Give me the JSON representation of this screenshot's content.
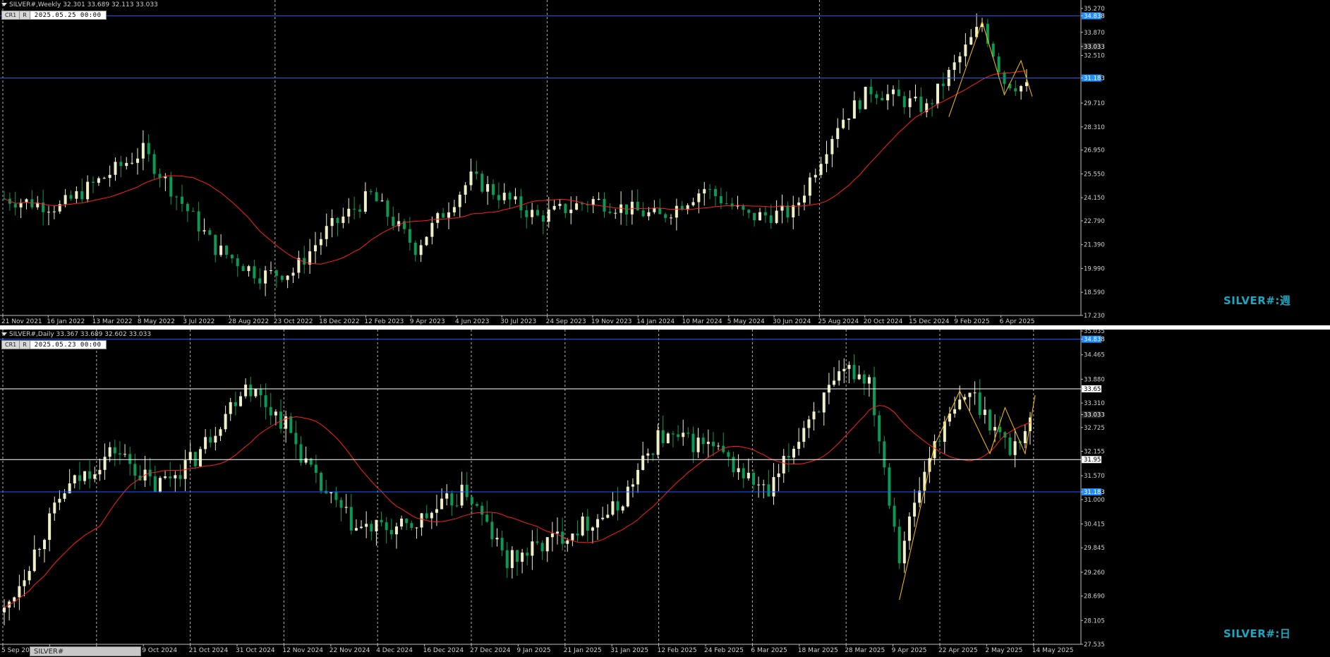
{
  "colors": {
    "bull": "#f0f0c8",
    "bear": "#0a9a55",
    "ma": "#ff2020",
    "zigzag": "#ffc000",
    "hline_blue": "#1e5cff",
    "hline_white": "#ffffff",
    "price_tag": "#1e8cff",
    "grid": "#c0c0c0",
    "text": "#d0d0d0",
    "watermark": "#1aa7c0"
  },
  "weekly": {
    "header": "SILVER#,Weekly  32.301 33.689 32.113 33.033",
    "cr_label": "CR1",
    "r_label": "R",
    "date": "2025.05.25 00:00",
    "watermark": "SILVER#:週",
    "price_labels": [
      "35.270",
      "34.838",
      "33.870",
      "33.033",
      "32.510",
      "31.183",
      "29.710",
      "28.310",
      "26.950",
      "25.550",
      "24.150",
      "22.790",
      "21.390",
      "19.990",
      "18.590",
      "17.230"
    ],
    "time_labels": [
      "21 Nov 2021",
      "16 Jan 2022",
      "13 Mar 2022",
      "8 May 2022",
      "3 Jul 2022",
      "28 Aug 2022",
      "23 Oct 2022",
      "18 Dec 2022",
      "12 Feb 2023",
      "9 Apr 2023",
      "4 Jun 2023",
      "30 Jul 2023",
      "24 Sep 2023",
      "19 Nov 2023",
      "14 Jan 2024",
      "10 Mar 2024",
      "5 May 2024",
      "30 Jun 2024",
      "25 Aug 2024",
      "20 Oct 2024",
      "15 Dec 2024",
      "9 Feb 2025",
      "6 Apr 2025"
    ]
  },
  "daily": {
    "header": "SILVER#,Daily  33.367 33.689 32.602 33.033",
    "cr_label": "CR1",
    "r_label": "R",
    "date": "2025.05.23 00:00",
    "watermark": "SILVER#:日",
    "price_labels": [
      "35.035",
      "34.838",
      "34.465",
      "33.880",
      "33.650",
      "33.310",
      "33.033",
      "32.725",
      "32.155",
      "31.957",
      "31.570",
      "31.183",
      "31.000",
      "30.415",
      "29.845",
      "29.260",
      "28.690",
      "28.105",
      "27.535"
    ],
    "time_labels": [
      "5 Sep 2024",
      "17 Sep 2024",
      "27 Sep 2024",
      "9 Oct 2024",
      "21 Oct 2024",
      "31 Oct 2024",
      "12 Nov 2024",
      "22 Nov 2024",
      "4 Dec 2024",
      "16 Dec 2024",
      "27 Dec 2024",
      "9 Jan 2025",
      "21 Jan 2025",
      "31 Jan 2025",
      "12 Feb 2025",
      "24 Feb 2025",
      "6 Mar 2025",
      "18 Mar 2025",
      "28 Mar 2025",
      "9 Apr 2025",
      "22 Apr 2025",
      "2 May 2025",
      "14 May 2025"
    ]
  },
  "bottom_tab": "SILVER#"
}
